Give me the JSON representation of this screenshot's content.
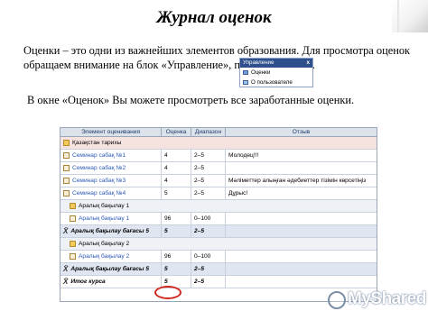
{
  "title": "Журнал оценок",
  "intro": "Оценки – это одни из важнейших элементов образования. Для просмотра оценок обращаем внимание на блок «Управление», пункт «Оценки».",
  "note": "В окне «Оценок» Вы можете просмотреть все заработанные оценки.",
  "menu": {
    "header": "Управление",
    "close": "x",
    "items": [
      {
        "label": "Оценки",
        "icon": "grades-icon"
      },
      {
        "label": "О пользователе",
        "icon": "user-icon"
      }
    ]
  },
  "table": {
    "headers": [
      "Элемент оценивания",
      "Оценка",
      "Диапазон",
      "Отзыв"
    ],
    "category": "Қазақстан тарихы",
    "rows1": [
      {
        "name": "Семинар сабақ №1",
        "grade": "4",
        "range": "2–5",
        "feedback": "Молодец!!!"
      },
      {
        "name": "Семинар сабақ №2",
        "grade": "4",
        "range": "2–5",
        "feedback": ""
      },
      {
        "name": "Семинар сабақ №3",
        "grade": "4",
        "range": "2–5",
        "feedback": "Мәліметтер алыңған әдебиеттер тізімін көрсетіңіз"
      },
      {
        "name": "Семинар сабақ №4",
        "grade": "5",
        "range": "2–5",
        "feedback": "Дұрыс!"
      }
    ],
    "section1": {
      "name": "Аралық бақылау 1",
      "item": {
        "name": "Аралық бақылау 1",
        "grade": "96",
        "range": "0–100",
        "feedback": ""
      },
      "total": {
        "name": "Аралық бақылау бағасы 5",
        "grade": "5",
        "range": "2–5"
      }
    },
    "section2": {
      "name": "Аралық бақылау 2",
      "item": {
        "name": "Аралық бақылау 2",
        "grade": "96",
        "range": "0–100",
        "feedback": ""
      },
      "total": {
        "name": "Аралық бақылау бағасы 5",
        "grade": "5",
        "range": "2–5"
      }
    },
    "final": {
      "name": "Итог курса",
      "grade": "5",
      "range": "2–5"
    }
  },
  "watermark": "MyShared"
}
